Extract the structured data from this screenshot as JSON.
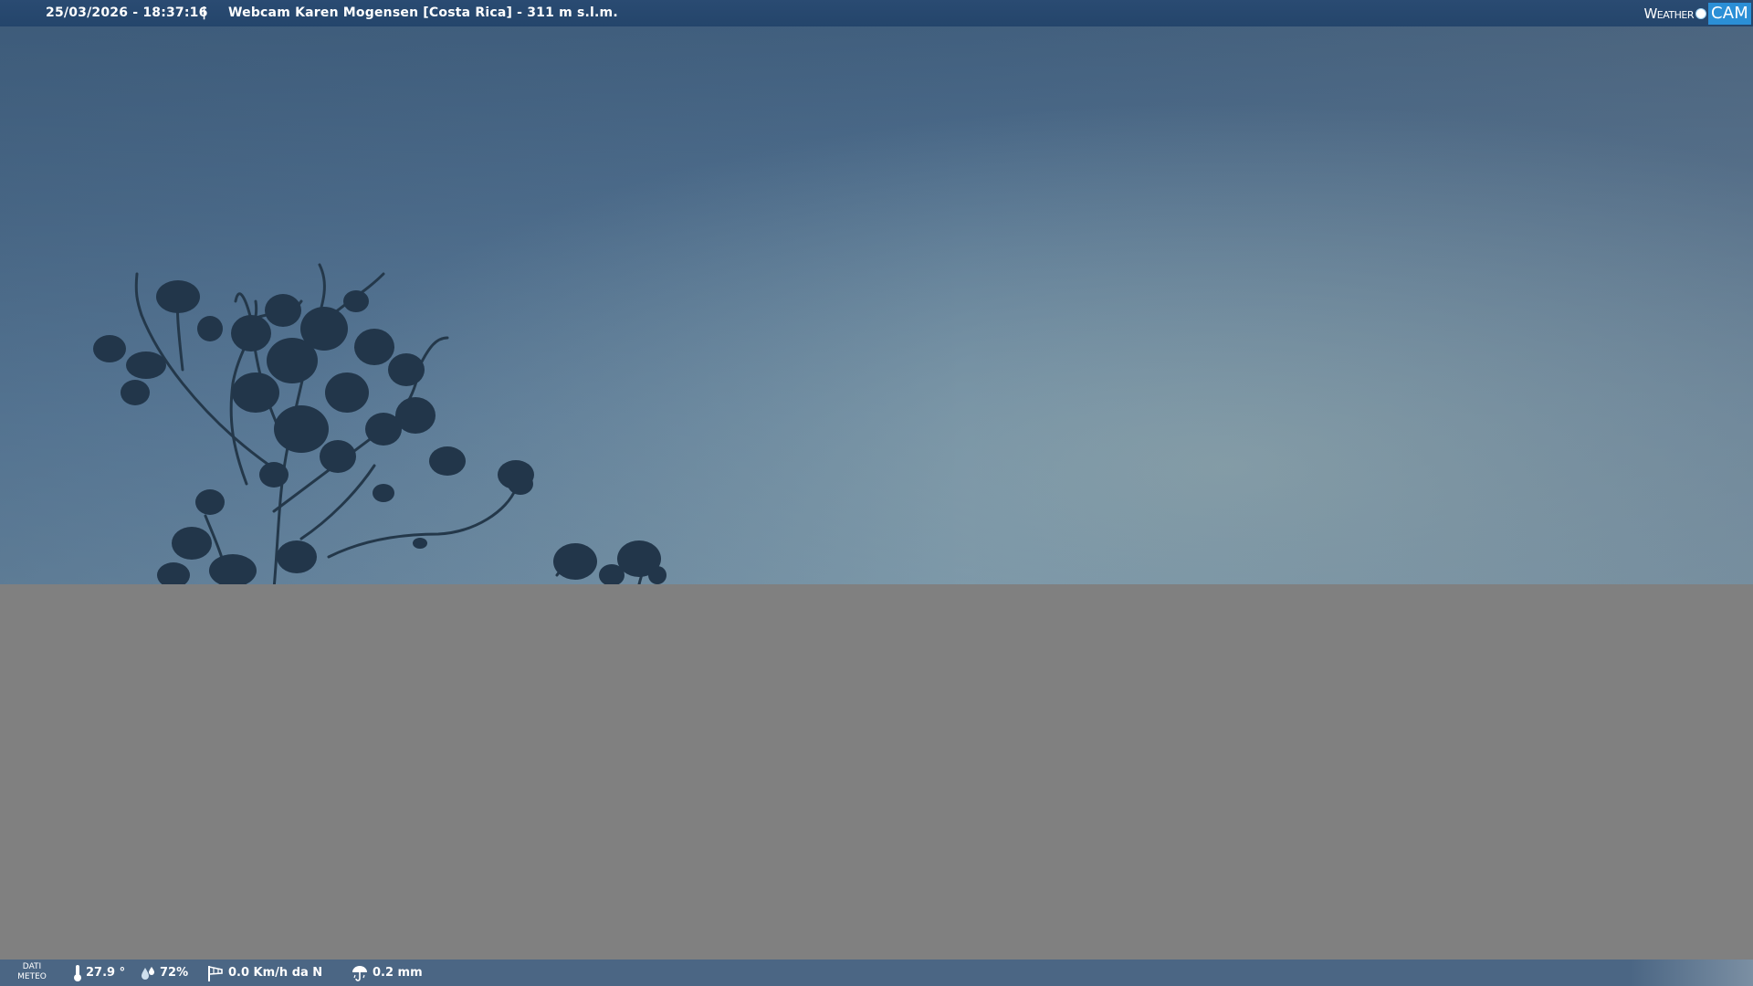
{
  "top_bar": {
    "datetime": "25/03/2026 - 18:37:16",
    "separator": "|",
    "title": "Webcam Karen Mogensen [Costa Rica]  - 311 m s.l.m."
  },
  "logo": {
    "weather": "Weather",
    "cam": "CAM"
  },
  "bottom_bar": {
    "label_line1": "DATI",
    "label_line2": "METEO",
    "temperature": "27.9 °",
    "humidity": "72%",
    "wind": "0.0 Km/h da N",
    "rain": "0.2 mm"
  },
  "colors": {
    "top_bar": "#24456b",
    "bottom_bar": "#4b6684",
    "mask": "#808080",
    "logo_cam": "#2b8fd6"
  },
  "icons": {
    "temperature": "thermometer-icon",
    "humidity": "humidity-drops-icon",
    "wind": "wind-sock-icon",
    "rain": "rain-gauge-icon"
  }
}
